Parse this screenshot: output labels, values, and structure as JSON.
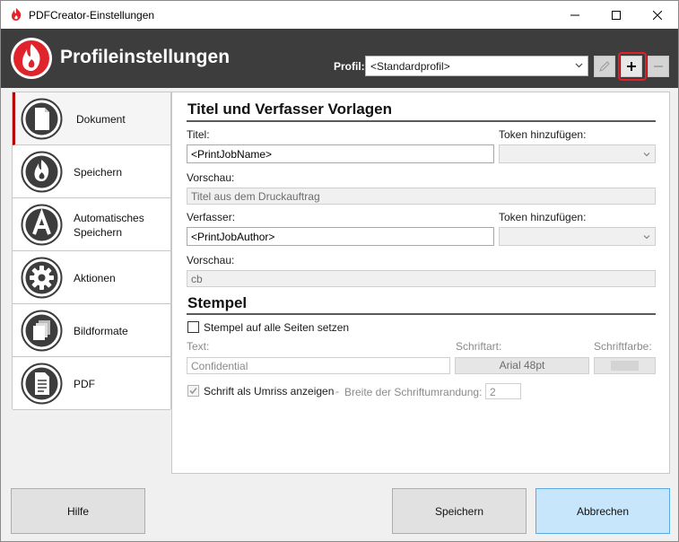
{
  "window": {
    "title": "PDFCreator-Einstellungen",
    "controls": [
      "minimize",
      "maximize",
      "close"
    ]
  },
  "header": {
    "heading": "Profileinstellungen",
    "profile_label": "Profil:",
    "profile_value": "<Standardprofil>",
    "buttons": [
      "rename-icon",
      "add-icon",
      "remove-icon"
    ]
  },
  "sidebar": {
    "items": [
      {
        "label": "Dokument",
        "icon": "document-icon",
        "active": true
      },
      {
        "label": "Speichern",
        "icon": "flame-icon",
        "active": false
      },
      {
        "label_line1": "Automatisches",
        "label_line2": "Speichern",
        "icon": "auto-save-icon",
        "active": false
      },
      {
        "label": "Aktionen",
        "icon": "gear-icon",
        "active": false
      },
      {
        "label": "Bildformate",
        "icon": "image-stack-icon",
        "active": false
      },
      {
        "label": "PDF",
        "icon": "pdf-icon",
        "active": false
      }
    ]
  },
  "title_section": {
    "heading": "Titel und Verfasser Vorlagen",
    "title_label": "Titel:",
    "title_value": "<PrintJobName>",
    "token_label_1": "Token hinzufügen:",
    "preview_label_1": "Vorschau:",
    "preview_value_1": "Titel aus dem Druckauftrag",
    "author_label": "Verfasser:",
    "author_value": "<PrintJobAuthor>",
    "token_label_2": "Token hinzufügen:",
    "preview_label_2": "Vorschau:",
    "preview_value_2": "cb"
  },
  "stamp_section": {
    "heading": "Stempel",
    "all_pages_label": "Stempel auf alle Seiten setzen",
    "all_pages_checked": false,
    "text_label": "Text:",
    "text_value": "Confidential",
    "font_label": "Schriftart:",
    "font_value": "Arial 48pt",
    "color_label": "Schriftfarbe:",
    "color_value": "#d4d4d4",
    "outline_label": "Schrift als Umriss anzeigen",
    "outline_checked": true,
    "dash": "-",
    "outline_width_label": "Breite der Schriftumrandung:",
    "outline_width_value": "2"
  },
  "footer": {
    "help_label": "Hilfe",
    "save_label": "Speichern",
    "cancel_label": "Abbrechen"
  },
  "colors": {
    "header_bg": "#3d3d3d",
    "brand_red": "#e0242c",
    "active_marker": "#b80000",
    "primary_button": "#c7e6fb"
  }
}
